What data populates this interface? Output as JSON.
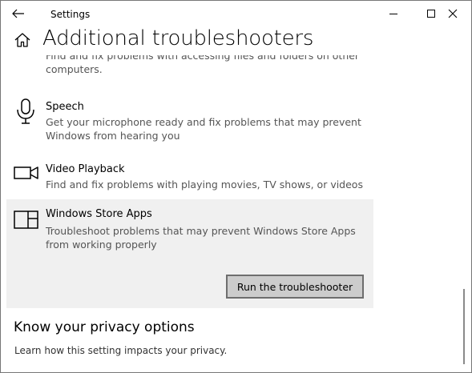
{
  "window": {
    "title": "Settings"
  },
  "header": {
    "page_title": "Additional troubleshooters"
  },
  "items": [
    {
      "icon": "shared-folders-icon",
      "name": "",
      "description": "Find and fix problems with accessing files and folders on other computers."
    },
    {
      "icon": "microphone-icon",
      "name": "Speech",
      "description": "Get your microphone ready and fix problems that may prevent Windows from hearing you"
    },
    {
      "icon": "video-camera-icon",
      "name": "Video Playback",
      "description": "Find and fix problems with playing movies, TV shows, or videos"
    },
    {
      "icon": "store-apps-icon",
      "name": "Windows Store Apps",
      "description": "Troubleshoot problems that may prevent Windows Store Apps from working properly",
      "button_label": "Run the troubleshooter"
    }
  ],
  "privacy": {
    "title": "Know your privacy options",
    "link": "Learn how this setting impacts your privacy."
  },
  "colors": {
    "selected_bg": "#f0f0f0",
    "button_bg": "#cccccc",
    "button_border": "#6e6e6e",
    "secondary_text": "#555555"
  }
}
